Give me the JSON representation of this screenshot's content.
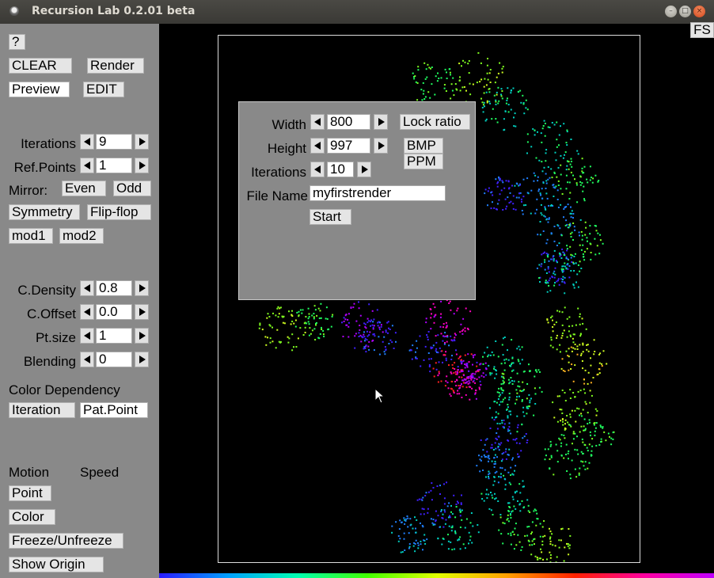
{
  "window": {
    "title": "Recursion Lab 0.2.01 beta"
  },
  "sidebar": {
    "help_label": "?",
    "clear_label": "CLEAR",
    "render_label": "Render",
    "preview_label": "Preview",
    "edit_label": "EDIT",
    "iterations": {
      "label": "Iterations",
      "value": "9"
    },
    "ref_points": {
      "label": "Ref.Points",
      "value": "1"
    },
    "mirror": {
      "label": "Mirror:",
      "even_label": "Even",
      "odd_label": "Odd"
    },
    "symmetry_label": "Symmetry",
    "flipflop_label": "Flip-flop",
    "mod1_label": "mod1",
    "mod2_label": "mod2",
    "c_density": {
      "label": "C.Density",
      "value": "0.8"
    },
    "c_offset": {
      "label": "C.Offset",
      "value": "0.0"
    },
    "pt_size": {
      "label": "Pt.size",
      "value": "1"
    },
    "blending": {
      "label": "Blending",
      "value": "0"
    },
    "color_dependency": {
      "label": "Color Dependency",
      "iteration_label": "Iteration",
      "patpoint_label": "Pat.Point"
    },
    "motion_label": "Motion",
    "speed_label": "Speed",
    "point_label": "Point",
    "color_label": "Color",
    "freeze_label": "Freeze/Unfreeze",
    "show_origin_label": "Show Origin"
  },
  "canvas": {
    "fs_label": "FS"
  },
  "render_dialog": {
    "width": {
      "label": "Width",
      "value": "800"
    },
    "height": {
      "label": "Height",
      "value": "997"
    },
    "iterations": {
      "label": "Iterations",
      "value": "10"
    },
    "lock_ratio_label": "Lock ratio",
    "bmp_label": "BMP",
    "ppm_label": "PPM",
    "file_name": {
      "label": "File Name",
      "value": "myfirstrender"
    },
    "start_label": "Start"
  },
  "fractal_colors": [
    "#ff2020",
    "#ff00c0",
    "#b000ff",
    "#4020ff",
    "#2080ff",
    "#00d0c0",
    "#20ff60",
    "#80ff20",
    "#d0ff20",
    "#ffb020"
  ]
}
